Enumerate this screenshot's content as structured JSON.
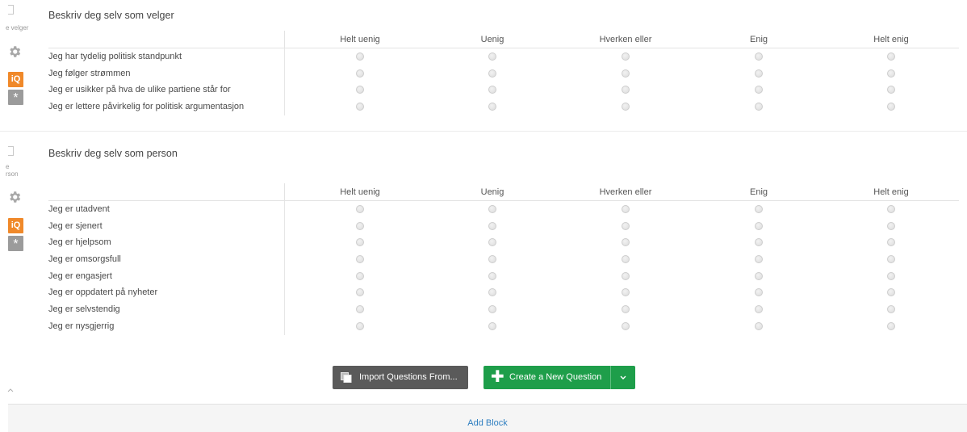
{
  "blocks": [
    {
      "rail_label": "e velger",
      "title": "Beskriv deg selv som velger",
      "columns": [
        "Helt uenig",
        "Uenig",
        "Hverken eller",
        "Enig",
        "Helt enig"
      ],
      "rows": [
        "Jeg har tydelig politisk standpunkt",
        "Jeg følger strømmen",
        "Jeg er usikker på hva de ulike partiene står for",
        "Jeg er lettere påvirkelig for politisk argumentasjon"
      ]
    },
    {
      "rail_label": "e\nrson",
      "title": "Beskriv deg selv som person",
      "columns": [
        "Helt uenig",
        "Uenig",
        "Hverken eller",
        "Enig",
        "Helt enig"
      ],
      "rows": [
        "Jeg er utadvent",
        "Jeg er sjenert",
        "Jeg er hjelpsom",
        "Jeg er omsorgsfull",
        "Jeg er engasjert",
        "Jeg er oppdatert på nyheter",
        "Jeg er selvstendig",
        "Jeg er nysgjerrig"
      ]
    }
  ],
  "rail": {
    "iq_label": "iQ",
    "star_label": "*"
  },
  "actions": {
    "import_label": "Import Questions From...",
    "create_label": "Create a New Question",
    "add_block_label": "Add Block"
  },
  "icons": {
    "gear": "gear-icon",
    "iq": "iq-icon",
    "asterisk": "asterisk-icon",
    "import": "copy-icon",
    "plus": "plus-icon",
    "dropdown": "chevron-down-icon"
  },
  "colors": {
    "create_button": "#1e9e4a",
    "import_button": "#5a5a5a",
    "iq_badge": "#f0892a",
    "link": "#2f7fc1"
  }
}
